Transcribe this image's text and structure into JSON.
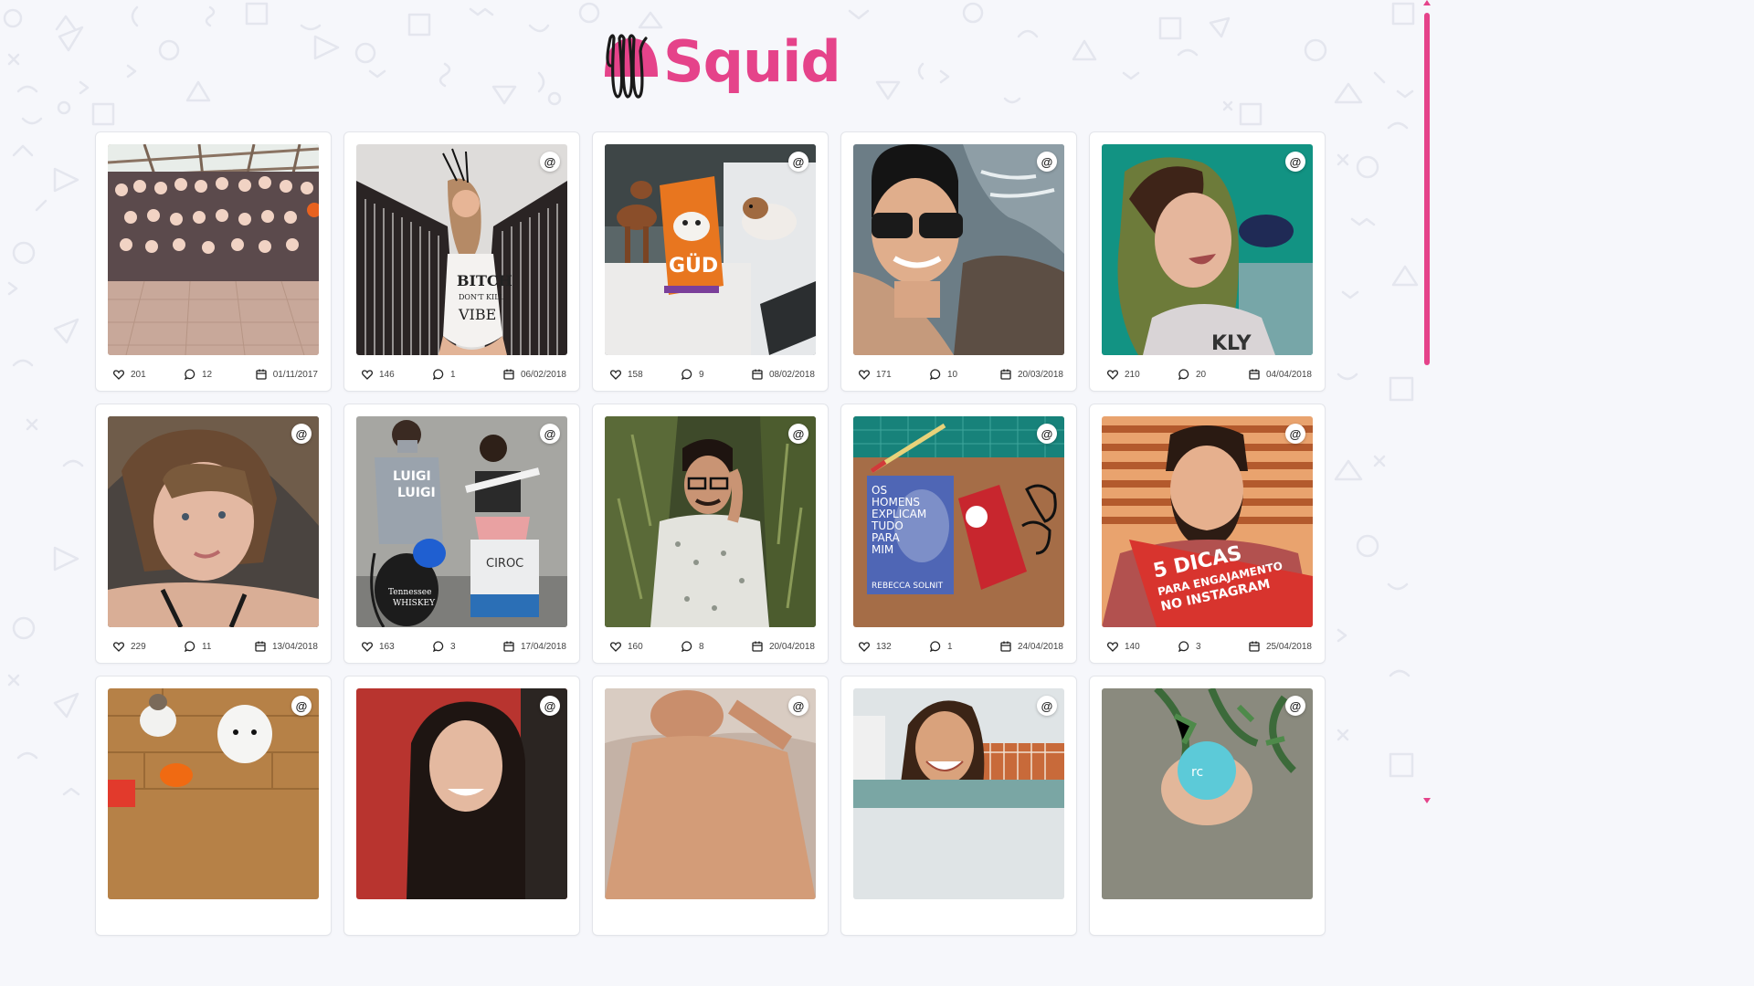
{
  "brand": {
    "name": "Squid",
    "color": "#e5438a"
  },
  "posts": [
    {
      "likes": "201",
      "comments": "12",
      "date": "01/11/2017",
      "mention": false,
      "photo": "group-photo"
    },
    {
      "likes": "146",
      "comments": "1",
      "date": "06/02/2018",
      "mention": true,
      "photo": "woman-fringe-shawl"
    },
    {
      "likes": "158",
      "comments": "9",
      "date": "08/02/2018",
      "mention": true,
      "photo": "dachshunds-dog-food"
    },
    {
      "likes": "171",
      "comments": "10",
      "date": "20/03/2018",
      "mention": true,
      "photo": "man-sunglasses-sea"
    },
    {
      "likes": "210",
      "comments": "20",
      "date": "04/04/2018",
      "mention": true,
      "photo": "woman-selfie-green"
    },
    {
      "likes": "229",
      "comments": "11",
      "date": "13/04/2018",
      "mention": true,
      "photo": "woman-selfie"
    },
    {
      "likes": "163",
      "comments": "3",
      "date": "17/04/2018",
      "mention": true,
      "photo": "men-vacuum-cleaner"
    },
    {
      "likes": "160",
      "comments": "8",
      "date": "20/04/2018",
      "mention": true,
      "photo": "man-garden"
    },
    {
      "likes": "132",
      "comments": "1",
      "date": "24/04/2018",
      "mention": true,
      "photo": "book-snack-desk"
    },
    {
      "likes": "140",
      "comments": "3",
      "date": "25/04/2018",
      "mention": true,
      "photo": "man-5-dicas",
      "overlay_text": [
        "5 DICAS",
        "PARA ENGAJAMENTO",
        "NO INSTAGRAM"
      ]
    },
    {
      "mention": true,
      "photo": "cat-dog-floor"
    },
    {
      "mention": true,
      "photo": "woman-smile-red"
    },
    {
      "mention": true,
      "photo": "man-bed"
    },
    {
      "mention": true,
      "photo": "woman-laughing-balcony"
    },
    {
      "mention": true,
      "photo": "hand-cosmetic-jar"
    }
  ]
}
